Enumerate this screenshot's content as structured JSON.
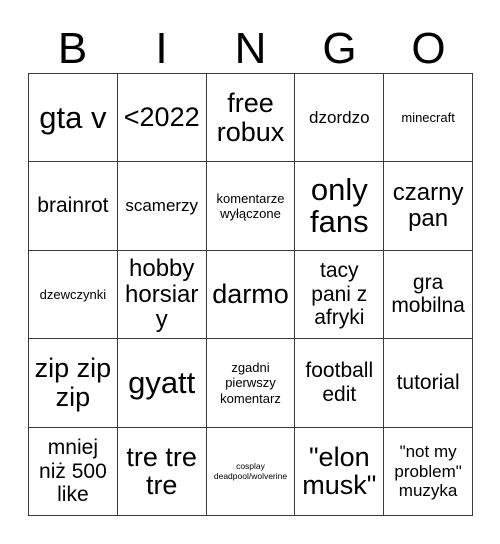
{
  "card": {
    "header_letters": [
      "B",
      "I",
      "N",
      "G",
      "O"
    ],
    "grid_size": "5x5",
    "background_color": "#ffffff",
    "border_color": "#3a3a3a",
    "text_color": "#000000",
    "rows": [
      [
        {
          "text": "gta v",
          "size": "xxl"
        },
        {
          "text": "<2022",
          "size": "xl"
        },
        {
          "text": "free\nrobux",
          "size": "xl"
        },
        {
          "text": "dzordzo",
          "size": "sm"
        },
        {
          "text": "minecraft",
          "size": "xs"
        }
      ],
      [
        {
          "text": "brainrot",
          "size": "md"
        },
        {
          "text": "scamerzy",
          "size": "sm"
        },
        {
          "text": "komentarze\nwyłączone",
          "size": "xs"
        },
        {
          "text": "only\nfans",
          "size": "xxl"
        },
        {
          "text": "czarny\npan",
          "size": "lg"
        }
      ],
      [
        {
          "text": "dzewczynki",
          "size": "xs"
        },
        {
          "text": "hobby\nhorsiary",
          "size": "lg"
        },
        {
          "text": "darmo",
          "size": "xl"
        },
        {
          "text": "tacy\npani z\nafryki",
          "size": "md"
        },
        {
          "text": "gra\nmobilna",
          "size": "md"
        }
      ],
      [
        {
          "text": "zip zip\nzip",
          "size": "xl"
        },
        {
          "text": "gyatt",
          "size": "xxl"
        },
        {
          "text": "zgadni\npierwszy\nkomentarz",
          "size": "xs"
        },
        {
          "text": "football\nedit",
          "size": "md"
        },
        {
          "text": "tutorial",
          "size": "md"
        }
      ],
      [
        {
          "text": "mniej\nniż 500\nlike",
          "size": "md"
        },
        {
          "text": "tre tre\ntre",
          "size": "xl"
        },
        {
          "text": "cosplay\ndeadpool/wolverine",
          "size": "xxs"
        },
        {
          "text": "\"elon\nmusk\"",
          "size": "xl"
        },
        {
          "text": "\"not my\nproblem\"\nmuzyka",
          "size": "sm"
        }
      ]
    ]
  }
}
